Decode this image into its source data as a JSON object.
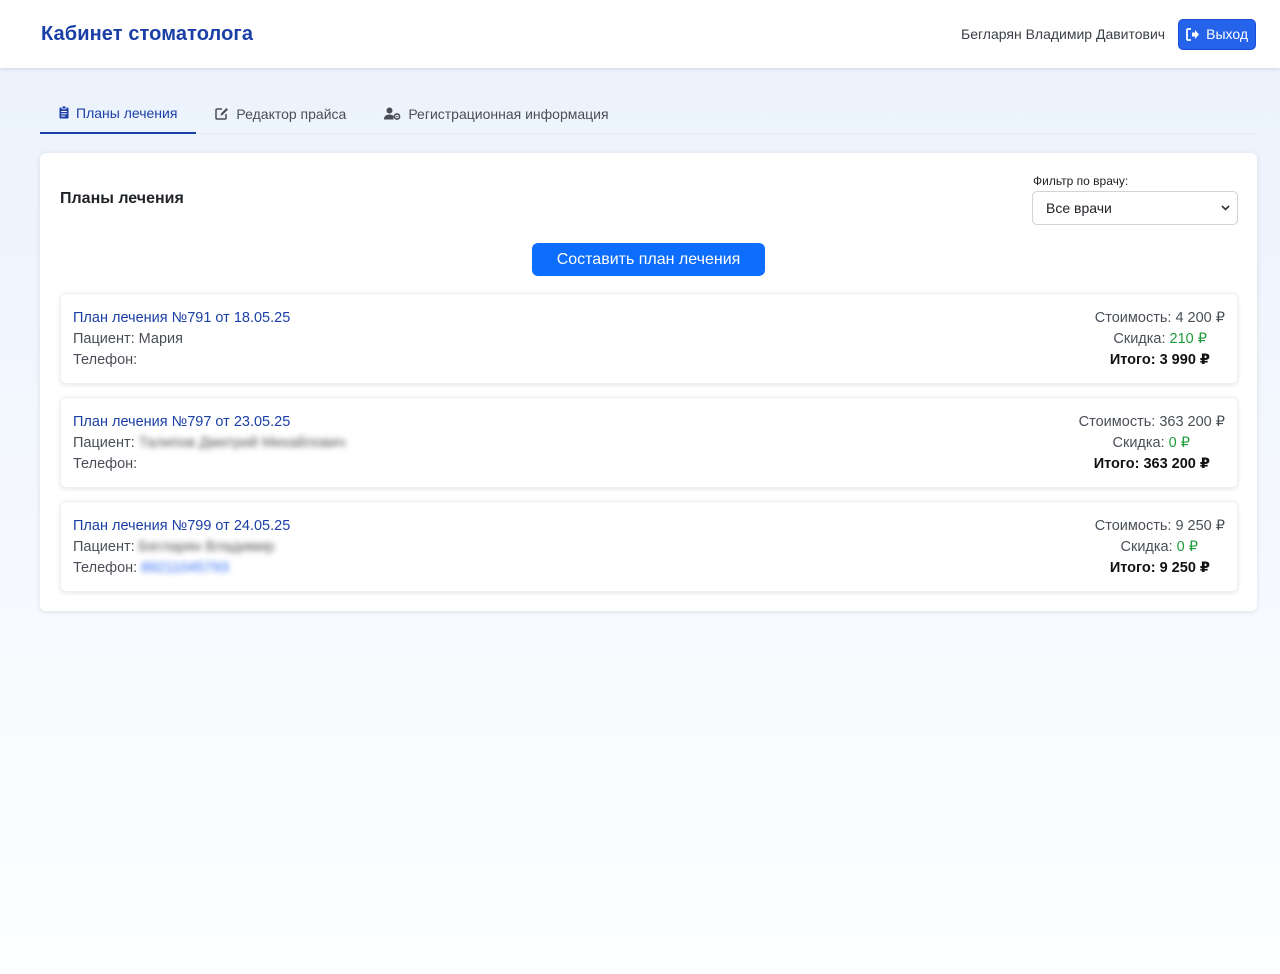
{
  "header": {
    "title": "Кабинет стоматолога",
    "user_name": "Бегларян Владимир Давитович",
    "logout_label": "Выход"
  },
  "tabs": [
    {
      "label": "Планы лечения",
      "icon": "clipboard-icon",
      "active": true
    },
    {
      "label": "Редактор прайса",
      "icon": "edit-icon",
      "active": false
    },
    {
      "label": "Регистрационная информация",
      "icon": "user-gear-icon",
      "active": false
    }
  ],
  "main": {
    "section_title": "Планы лечения",
    "filter_label": "Фильтр по врачу:",
    "filter_value": "Все врачи",
    "create_label": "Составить план лечения"
  },
  "labels": {
    "patient": "Пациент:",
    "phone": "Телефон:",
    "cost": "Стоимость:",
    "discount": "Скидка:",
    "total": "Итого:"
  },
  "plans": [
    {
      "title": "План лечения №791 от 18.05.25",
      "patient": "Мария",
      "patient_blurred": false,
      "phone": "",
      "cost": "4 200 ₽",
      "discount": "210 ₽",
      "total": "3 990 ₽"
    },
    {
      "title": "План лечения №797 от 23.05.25",
      "patient": "Талипов Дмитрий Михайлович",
      "patient_blurred": true,
      "phone": "",
      "cost": "363 200 ₽",
      "discount": "0 ₽",
      "total": "363 200 ₽"
    },
    {
      "title": "План лечения №799 от 24.05.25",
      "patient": "Бегларян Владимир",
      "patient_blurred": true,
      "phone": "89211045793",
      "cost": "9 250 ₽",
      "discount": "0 ₽",
      "total": "9 250 ₽"
    }
  ],
  "colors": {
    "brand": "#1a3fa6",
    "primary_button": "#0d6efd",
    "discount": "#1e9b3c"
  }
}
